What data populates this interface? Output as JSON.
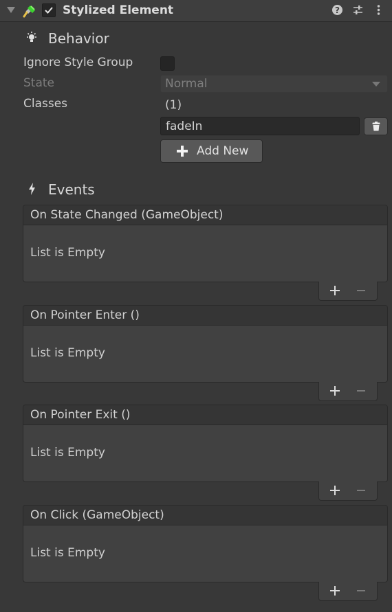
{
  "component": {
    "title": "Stylized Element",
    "enabled": true,
    "icons": [
      "fold-arrow-icon",
      "paintbrush-icon",
      "help-icon",
      "presets-icon",
      "context-menu-icon"
    ]
  },
  "behavior": {
    "title": "Behavior",
    "icon": "lightbulb-icon",
    "ignore_style_group": {
      "label": "Ignore Style Group",
      "checked": false
    },
    "state": {
      "label": "State",
      "value": "Normal"
    },
    "classes": {
      "label": "Classes",
      "count": "(1)",
      "items": [
        {
          "value": "fadeIn"
        }
      ],
      "add_label": "Add New"
    }
  },
  "events": {
    "title": "Events",
    "icon": "lightning-icon",
    "items": [
      {
        "title": "On State Changed (GameObject)",
        "empty_text": "List is Empty"
      },
      {
        "title": "On Pointer Enter ()",
        "empty_text": "List is Empty"
      },
      {
        "title": "On Pointer Exit ()",
        "empty_text": "List is Empty"
      },
      {
        "title": "On Click (GameObject)",
        "empty_text": "List is Empty"
      }
    ]
  },
  "colors": {
    "background": "#383838",
    "header": "#3e3e3e",
    "field": "#2a2a2a",
    "button": "#585858",
    "text": "#d2d2d2",
    "disabled_text": "#7c7c7c"
  }
}
